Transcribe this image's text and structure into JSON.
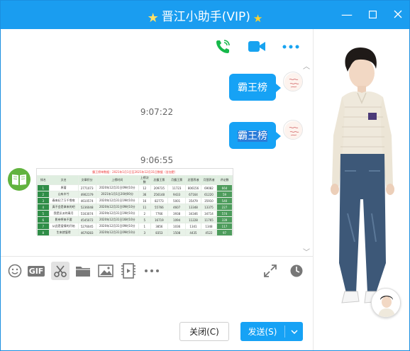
{
  "window": {
    "title": "晋江小助手(VIP)",
    "minimize_glyph": "—",
    "maximize_glyph": "☐",
    "close_glyph": "✕"
  },
  "chat_toolbar": {
    "icons": [
      "phone-call-icon",
      "video-call-icon",
      "more-icon"
    ]
  },
  "messages": [
    {
      "type": "text",
      "side": "right",
      "text": "霸王榜"
    },
    {
      "type": "time",
      "text": "9:07:22"
    },
    {
      "type": "text",
      "side": "right",
      "text": "霸王榜"
    },
    {
      "type": "time",
      "text": "9:06:55"
    },
    {
      "type": "image",
      "side": "left"
    }
  ],
  "ranking_image": {
    "heading": "霸王榜单数据：2021年1月1日至2021年12月31日数据（含加更）",
    "columns": [
      "排名",
      "文名",
      "文章积分",
      "上榜时间",
      "上榜次数",
      "总霸王票",
      "月霸王票",
      "总营养液",
      "月营养液",
      "评论数"
    ],
    "rows": [
      [
        "1",
        "原著",
        "2771073",
        "2020年12月31日09时10分",
        "12",
        "209735",
        "11723",
        "806156",
        "69082",
        "664"
      ],
      [
        "2",
        "山有木兮",
        "4902179",
        "2021年1月1日20时00分",
        "36",
        "256148",
        "9433",
        "67164",
        "61220",
        "59"
      ],
      [
        "3",
        "春来纪了万千雪夜",
        "4610574",
        "2020年12月31日19时10分",
        "16",
        "82773",
        "5001",
        "35479",
        "35910",
        "540"
      ],
      [
        "4",
        "真不会是拿来的吧",
        "5236048",
        "2020年12月31日09时10分",
        "11",
        "55766",
        "4607",
        "13348",
        "13375",
        "227"
      ],
      [
        "5",
        "我是反派的青月",
        "5163074",
        "2020年12月31日19时10分",
        "2",
        "7766",
        "3938",
        "34346",
        "34714",
        "574"
      ],
      [
        "6",
        "影帝将来不要",
        "4545072",
        "2020年12月31日16时10分",
        "5",
        "16719",
        "1094",
        "11228",
        "11765",
        "339"
      ],
      [
        "7",
        "从此是爱情的开始",
        "5276045",
        "2020年12月31日09时10分",
        "1",
        "3856",
        "1036",
        "1341",
        "1348",
        "117"
      ],
      [
        "8",
        "生来就值得",
        "4679283",
        "2020年12月31日09时10分",
        "3",
        "8353",
        "1508",
        "4435",
        "4522",
        "97"
      ]
    ]
  },
  "input_toolbar": {
    "icons": [
      "emoji-icon",
      "gif-icon",
      "screenshot-scissors-icon",
      "folder-icon",
      "image-icon",
      "video-clip-icon",
      "more-icon",
      "expand-icon",
      "history-clock-icon"
    ],
    "gif_label": "GIF"
  },
  "buttons": {
    "close_label": "关闭(C)",
    "send_label": "发送(S)"
  },
  "colors": {
    "accent": "#1a9df0",
    "bubble": "#16a2f5",
    "table_green": "#2f8d47"
  }
}
